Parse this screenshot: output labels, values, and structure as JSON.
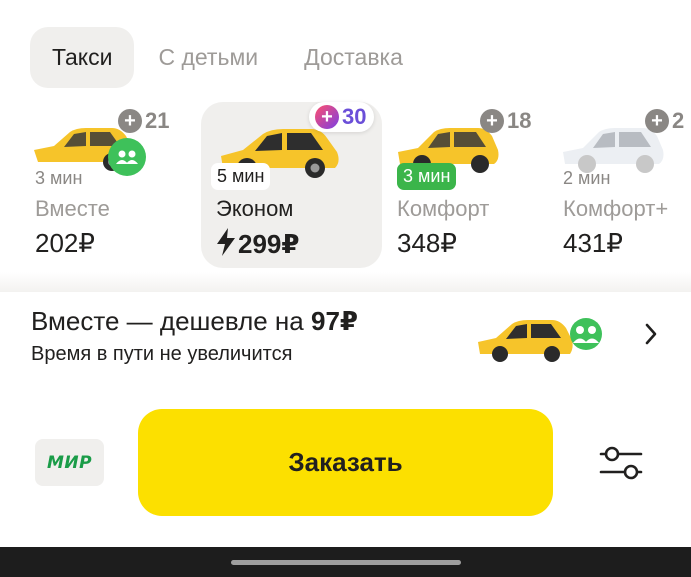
{
  "tabs": [
    {
      "label": "Такси",
      "active": true
    },
    {
      "label": "С детьми",
      "active": false
    },
    {
      "label": "Доставка",
      "active": false
    }
  ],
  "tariffs": [
    {
      "eta": "3 мин",
      "name": "Вместе",
      "price": "202₽",
      "plus_points": "21",
      "selected": false,
      "car_color": "yellow",
      "icon": "group-icon"
    },
    {
      "eta": "5 мин",
      "name": "Эконом",
      "price": "299₽",
      "plus_points": "30",
      "selected": true,
      "car_color": "yellow",
      "icon": "bolt-icon"
    },
    {
      "eta": "3 мин",
      "name": "Комфорт",
      "price": "348₽",
      "plus_points": "18",
      "selected": false,
      "car_color": "yellow",
      "eta_style": "green"
    },
    {
      "eta": "2 мин",
      "name": "Комфорт+",
      "price": "431₽",
      "plus_points": "2",
      "selected": false,
      "car_color": "white"
    }
  ],
  "promo": {
    "title": "Вместе — дешевле на",
    "title_amount": "97₽",
    "subtitle": "Время в пути не увеличится"
  },
  "payment": {
    "label": "МИР"
  },
  "order_button": {
    "label": "Заказать"
  },
  "colors": {
    "accent_yellow": "#fce000",
    "plus_purple": "#6b4fd8",
    "green": "#3bb54a",
    "surface": "#f0efed"
  }
}
